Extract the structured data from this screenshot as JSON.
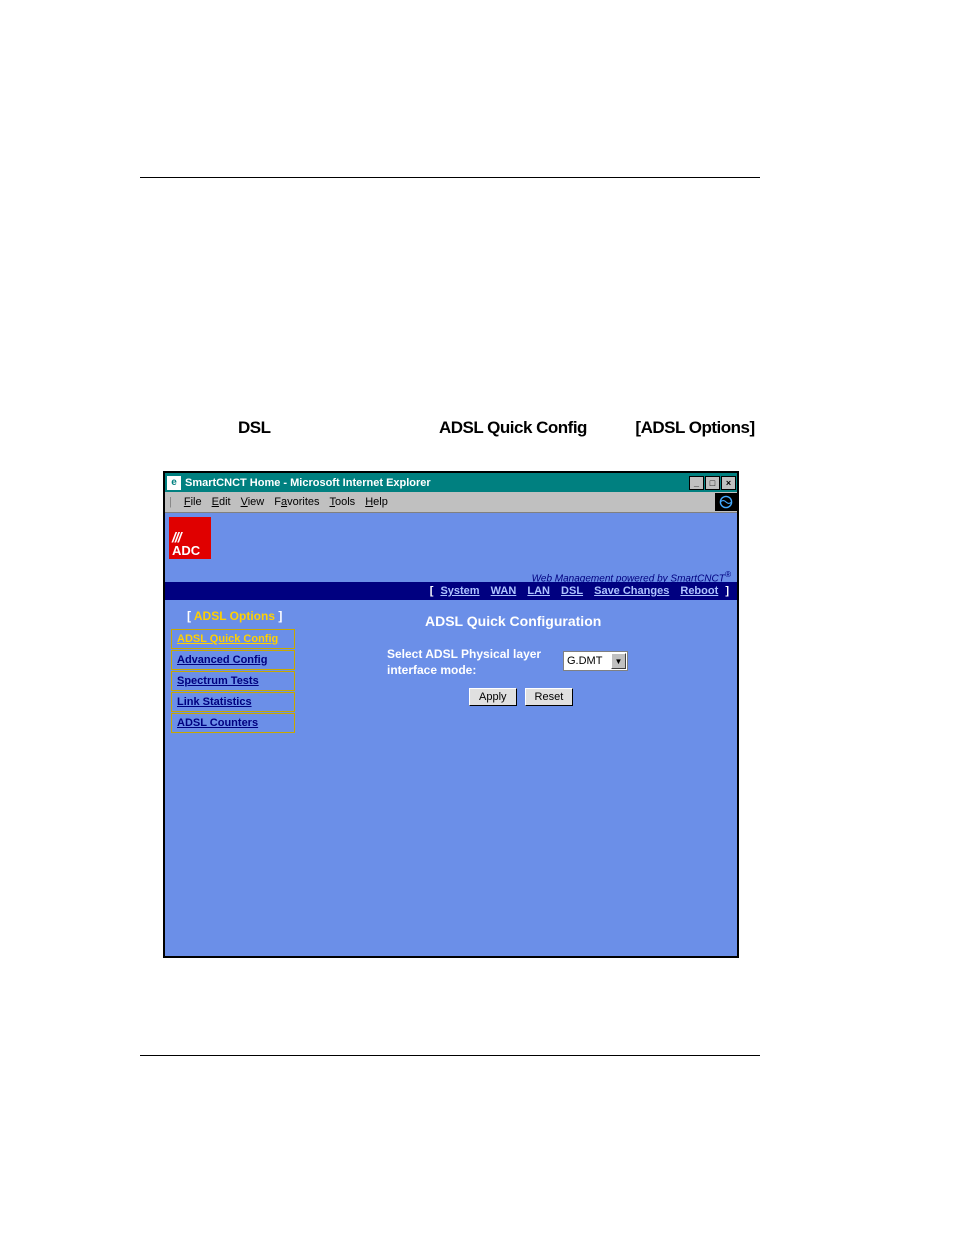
{
  "instruction": {
    "w1": "DSL",
    "w2": "ADSL Quick Config",
    "w3": "[ADSL Options]"
  },
  "window": {
    "title": "SmartCNCT Home - Microsoft Internet Explorer",
    "menus": {
      "file": "File",
      "edit": "Edit",
      "view": "View",
      "favorites": "Favorites",
      "tools": "Tools",
      "help": "Help"
    }
  },
  "tagline": "Web Management powered by SmartCNCT",
  "nav": {
    "system": "System",
    "wan": "WAN",
    "lan": "LAN",
    "dsl": "DSL",
    "save": "Save Changes",
    "reboot": "Reboot"
  },
  "side": {
    "header": "ADSL Options",
    "items": [
      "ADSL Quick Config",
      "Advanced Config",
      "Spectrum Tests",
      "Link Statistics",
      "ADSL Counters"
    ]
  },
  "main": {
    "title": "ADSL Quick Configuration",
    "label": "Select ADSL Physical layer interface mode:",
    "selected": "G.DMT",
    "apply": "Apply",
    "reset": "Reset"
  },
  "logo": "ADC"
}
